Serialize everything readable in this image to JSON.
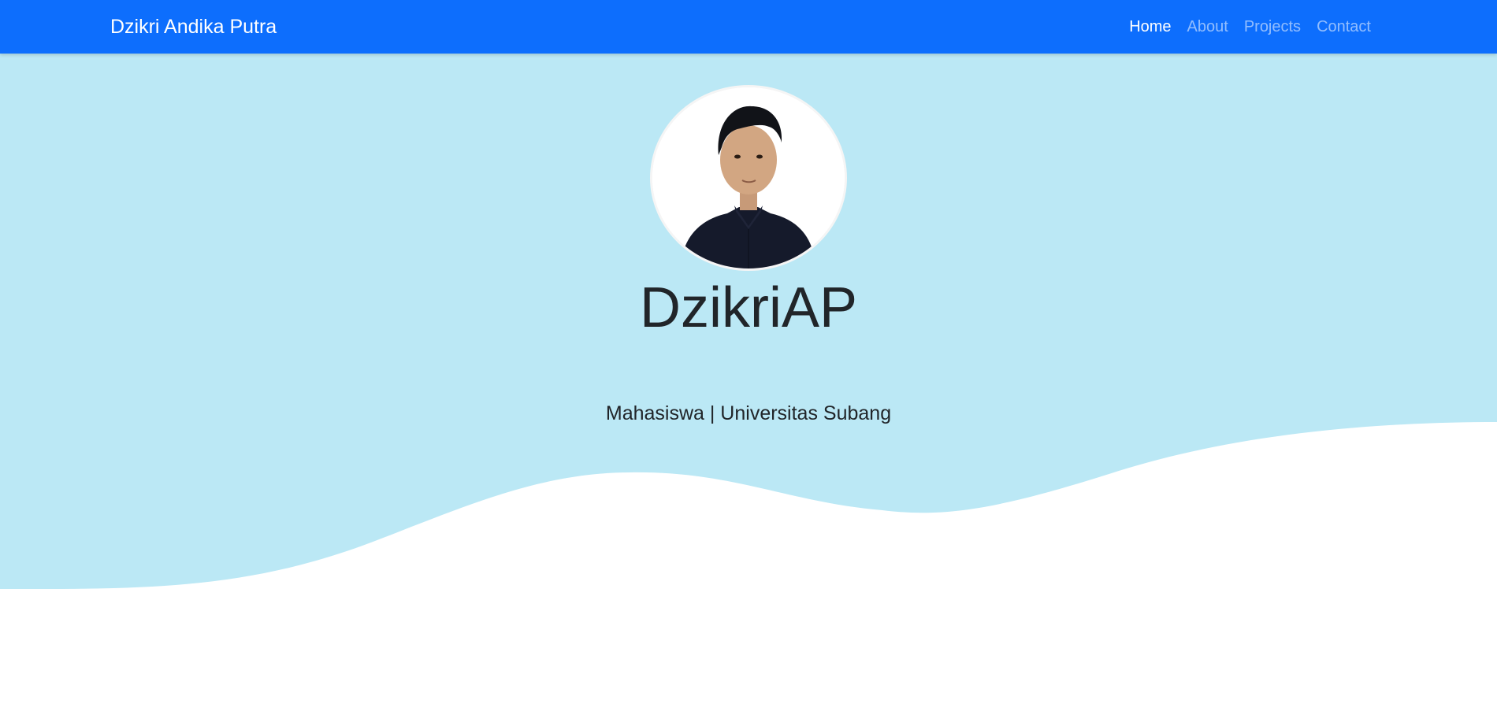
{
  "colors": {
    "navbar": "#0d6efd",
    "hero_bg": "#bbe8f5",
    "page_bg": "#ffffff",
    "text_dark": "#212529"
  },
  "navbar": {
    "brand": "Dzikri Andika Putra",
    "links": [
      {
        "label": "Home",
        "active": true
      },
      {
        "label": "About",
        "active": false
      },
      {
        "label": "Projects",
        "active": false
      },
      {
        "label": "Contact",
        "active": false
      }
    ]
  },
  "hero": {
    "avatar_icon": "profile-photo",
    "title": "DzikriAP",
    "subtitle": "Mahasiswa | Universitas Subang"
  }
}
